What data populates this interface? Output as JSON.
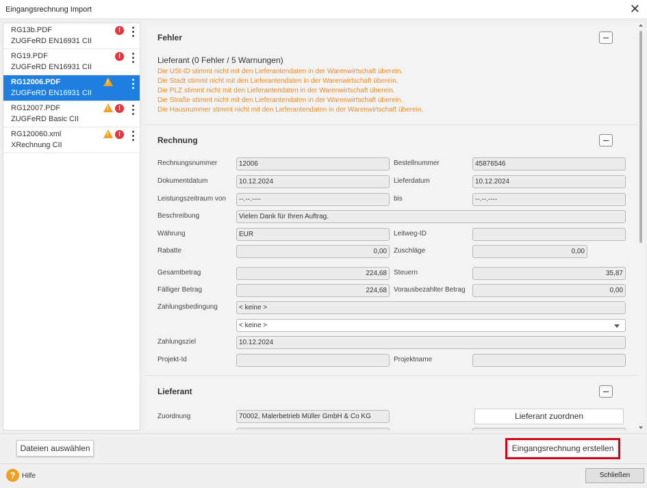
{
  "window": {
    "title": "Eingangsrechnung Import",
    "close_glyph": "✕"
  },
  "files": [
    {
      "name": "RG13b.PDF",
      "format": "ZUGFeRD EN16931 CII",
      "warning": false,
      "error": true
    },
    {
      "name": "RG19.PDF",
      "format": "ZUGFeRD EN16931 CII",
      "warning": false,
      "error": true
    },
    {
      "name": "RG12006.PDF",
      "format": "ZUGFeRD EN16931 CII",
      "warning": true,
      "error": false,
      "selected": true
    },
    {
      "name": "RG12007.PDF",
      "format": "ZUGFeRD Basic CII",
      "warning": true,
      "error": true
    },
    {
      "name": "RG120060.xml",
      "format": "XRechnung CII",
      "warning": true,
      "error": true
    }
  ],
  "icons": {
    "error": "error-icon",
    "warning": "warning-icon",
    "menu": "kebab-menu-icon",
    "collapse": "minus-icon",
    "help": "help-icon",
    "dropdown": "chevron-down-icon"
  },
  "colors": {
    "selected": "#1f7fe0",
    "error": "#e8323c",
    "warning": "#f0a020",
    "warning_text": "#f08a20",
    "highlight_frame": "#d0021b"
  },
  "fehler": {
    "title": "Fehler",
    "lieferant_summary": "Lieferant (0 Fehler / 5 Warnungen)",
    "warnings": [
      "Die USt-ID stimmt nicht mit den Lieferantendaten in der Warenwirtschaft überein.",
      "Die Stadt stimmt nicht mit den Lieferantendaten in der Warenwirtschaft überein.",
      "Die PLZ stimmt nicht mit den Lieferantendaten in der Warenwirtschaft überein.",
      "Die Straße stimmt nicht mit den Lieferantendaten in der Warenwirtschaft überein.",
      "Die Hausnummer stimmt nicht mit den Lieferantendaten in der Warenwirtschaft überein."
    ]
  },
  "rechnung": {
    "title": "Rechnung",
    "rechnungsnummer": {
      "label": "Rechnungsnummer",
      "value": "12006"
    },
    "bestellnummer": {
      "label": "Bestellnummer",
      "value": "45876546"
    },
    "dokumentdatum": {
      "label": "Dokumentdatum",
      "value": "10.12.2024"
    },
    "lieferdatum": {
      "label": "Lieferdatum",
      "value": "10.12.2024"
    },
    "leistungszeitraum_von": {
      "label": "Leistungszeitraum von",
      "value": "--.--.----"
    },
    "bis": {
      "label": "bis",
      "value": "--.--.----"
    },
    "beschreibung": {
      "label": "Beschreibung",
      "value": "Vielen Dank für Ihren Auftrag."
    },
    "waehrung": {
      "label": "Währung",
      "value": "EUR"
    },
    "leitweg_id": {
      "label": "Leitweg-ID",
      "value": ""
    },
    "rabatte": {
      "label": "Rabatte",
      "value": "0,00"
    },
    "zuschlaege": {
      "label": "Zuschläge",
      "value": "0,00"
    },
    "gesamtbetrag": {
      "label": "Gesamtbetrag",
      "value": "224,68"
    },
    "steuern": {
      "label": "Steuern",
      "value": "35,87"
    },
    "faelliger_betrag": {
      "label": "Fälliger Betrag",
      "value": "224,68"
    },
    "vorausbezahlter_betrag": {
      "label": "Vorausbezahlter Betrag",
      "value": "0,00"
    },
    "zahlungsbedingung": {
      "label": "Zahlungsbedingung",
      "value": "< keine >",
      "select_value": "< keine >"
    },
    "zahlungsziel": {
      "label": "Zahlungsziel",
      "value": "10.12.2024"
    },
    "projekt_id": {
      "label": "Projekt-Id",
      "value": ""
    },
    "projektname": {
      "label": "Projektname",
      "value": ""
    }
  },
  "lieferant": {
    "title": "Lieferant",
    "zuordnung": {
      "label": "Zuordnung",
      "value": "70002, Malerbetrieb Müller GmbH & Co KG"
    },
    "assign_button": "Lieferant zuordnen"
  },
  "footer": {
    "select_files": "Dateien auswählen",
    "create": "Eingangsrechnung erstellen",
    "help": "Hilfe",
    "close": "Schließen"
  }
}
